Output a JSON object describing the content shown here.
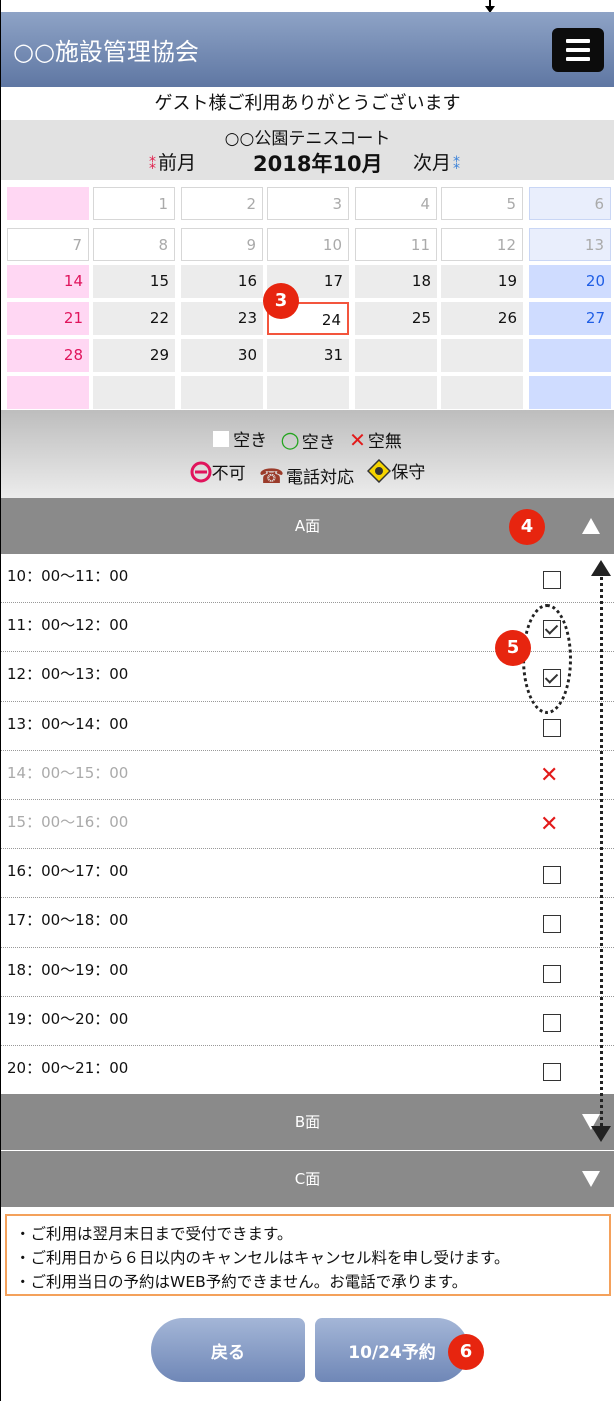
{
  "header": {
    "title": "○○施設管理協会",
    "menu_icon": "hamburger-icon"
  },
  "welcome": "ゲスト様ご利用ありがとうございます",
  "calendar": {
    "facility": "○○公園テニスコート",
    "prev_label": "前月",
    "month_label": "2018年10月",
    "next_label": "次月",
    "selected_date": "24",
    "days": {
      "d1": "1",
      "d2": "2",
      "d3": "3",
      "d4": "4",
      "d5": "5",
      "d6": "6",
      "d7": "7",
      "d8": "8",
      "d9": "9",
      "d10": "10",
      "d11": "11",
      "d12": "12",
      "d13": "13",
      "d14": "14",
      "d15": "15",
      "d16": "16",
      "d17": "17",
      "d18": "18",
      "d19": "19",
      "d20": "20",
      "d21": "21",
      "d22": "22",
      "d23": "23",
      "d24": "24",
      "d25": "25",
      "d26": "26",
      "d27": "27",
      "d28": "28",
      "d29": "29",
      "d30": "30",
      "d31": "31"
    }
  },
  "legend": {
    "vacant1": "空き",
    "vacant2": "空き",
    "none": "空無",
    "unavailable": "不可",
    "phone": "電話対応",
    "maintenance": "保守"
  },
  "sections": {
    "a": "A面",
    "b": "B面",
    "c": "C面"
  },
  "slots": [
    {
      "time": "10：00〜11：00",
      "state": "open"
    },
    {
      "time": "11：00〜12：00",
      "state": "checked"
    },
    {
      "time": "12：00〜13：00",
      "state": "checked"
    },
    {
      "time": "13：00〜14：00",
      "state": "open"
    },
    {
      "time": "14：00〜15：00",
      "state": "full"
    },
    {
      "time": "15：00〜16：00",
      "state": "full"
    },
    {
      "time": "16：00〜17：00",
      "state": "open"
    },
    {
      "time": "17：00〜18：00",
      "state": "open"
    },
    {
      "time": "18：00〜19：00",
      "state": "open"
    },
    {
      "time": "19：00〜20：00",
      "state": "open"
    },
    {
      "time": "20：00〜21：00",
      "state": "open"
    }
  ],
  "notes": {
    "n1": "・ご利用は翌月末日まで受付できます。",
    "n2": "・ご利用日から６日以内のキャンセルはキャンセル料を申し受けます。",
    "n3": "・ご利用当日の予約はWEB予約できません。お電話で承ります。"
  },
  "buttons": {
    "back": "戻る",
    "reserve": "10/24予約"
  },
  "badges": {
    "b3": "3",
    "b4": "4",
    "b5": "5",
    "b6": "6"
  },
  "colors": {
    "header": "#6f86b3",
    "sunday": "#ffd7f3",
    "saturday": "#cfdcff",
    "accent": "#e7250f"
  }
}
